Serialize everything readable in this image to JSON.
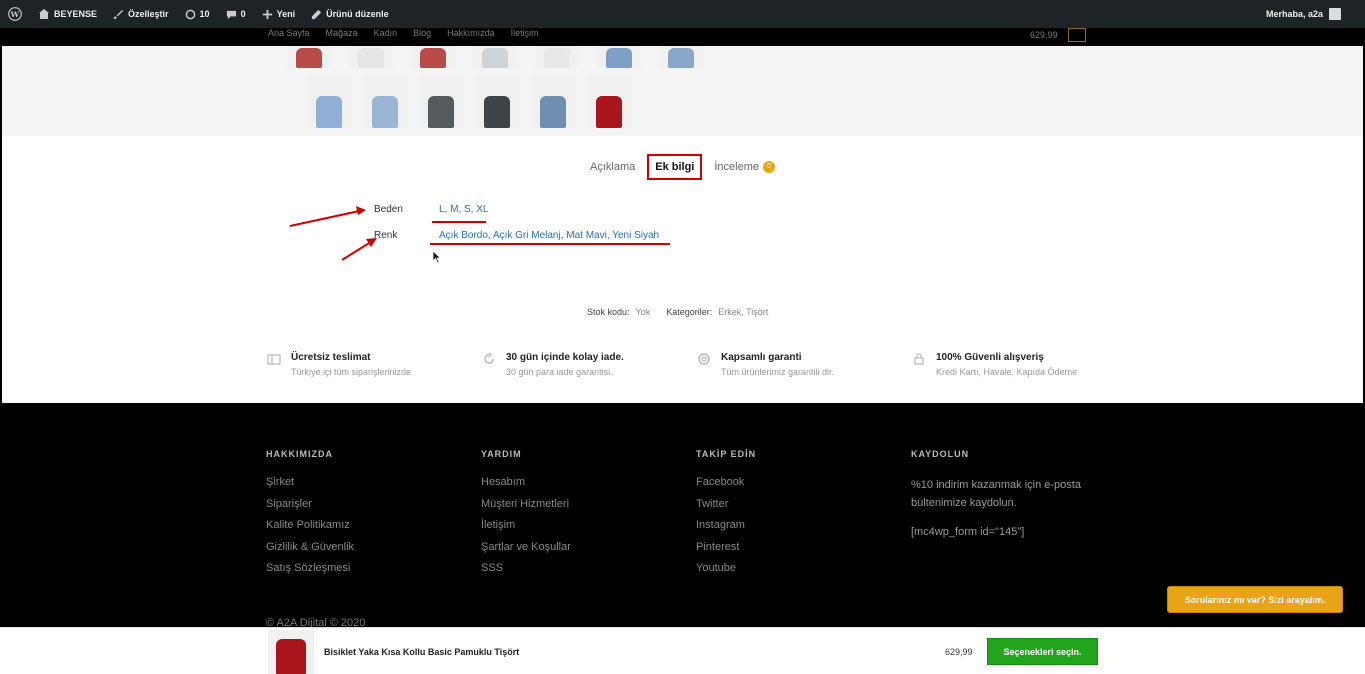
{
  "adminbar": {
    "site_name": "BEYENSE",
    "customize": "Özelleştir",
    "updates_count": "10",
    "comments_count": "0",
    "new": "Yeni",
    "edit_product": "Ürünü düzenle",
    "greeting": "Merhaba, a2a"
  },
  "header": {
    "nav": [
      "Ana Sayfa",
      "Mağaza",
      "Kadın",
      "Blog",
      "Hakkımızda",
      "İletişim"
    ],
    "cart_total": "629,99"
  },
  "thumbnails": {
    "top_colors": [
      "#b84a48",
      "#e5e5e5",
      "#b84a48",
      "#cfd3d8",
      "#e8e8e8",
      "#7ea0c7",
      "#8aa7c9"
    ],
    "bottom_colors": [
      "#8fb0d4",
      "#9ab6d4",
      "#555a5e",
      "#3f4448",
      "#6e8fb0",
      "#a8161c"
    ]
  },
  "tabs": {
    "description": "Açıklama",
    "additional_info": "Ek bilgi",
    "reviews": "İnceleme",
    "reviews_count": "0"
  },
  "attributes": {
    "size_label": "Beden",
    "size_value": "L, M, S, XL",
    "color_label": "Renk",
    "color_value": "Açık Bordo, Açık Gri Melanj, Mat Mavi, Yeni Siyah"
  },
  "meta": {
    "sku_label": "Stok kodu:",
    "sku_value": "Yok",
    "category_label": "Kategoriler:",
    "category_value": "Erkek, Tişört"
  },
  "features": [
    {
      "title": "Ücretsiz teslimat",
      "subtitle": "Türkiye içi tüm siparişlerinizde",
      "icon": "truck-icon"
    },
    {
      "title": "30 gün içinde kolay iade.",
      "subtitle": "30 gün para iade garantisi.",
      "icon": "refresh-icon"
    },
    {
      "title": "Kapsamlı garanti",
      "subtitle": "Tüm ürünlerimiz garantili dir.",
      "icon": "support-icon"
    },
    {
      "title": "100% Güvenli alışveriş",
      "subtitle": "Kredi Kartı, Havale, Kapıda Ödeme",
      "icon": "lock-icon"
    }
  ],
  "footer": {
    "about": {
      "heading": "HAKKIMIZDA",
      "links": [
        "Şirket",
        "Siparişler",
        "Kalite Politikamız",
        "Gizlilik & Güvenlik",
        "Satış Sözleşmesi"
      ]
    },
    "help": {
      "heading": "YARDIM",
      "links": [
        "Hesabım",
        "Müşteri Hizmetleri",
        "İletişim",
        "Şartlar ve Koşullar",
        "SSS"
      ]
    },
    "follow": {
      "heading": "TAKİP EDİN",
      "links": [
        "Facebook",
        "Twitter",
        "Instagram",
        "Pinterest",
        "Youtube"
      ]
    },
    "subscribe": {
      "heading": "KAYDOLUN",
      "text": "%10 indirim kazanmak için e-posta bültenimize kaydolun.",
      "shortcode": "[mc4wp_form id=\"145\"]"
    },
    "copyright": "© A2A Dijital © 2020"
  },
  "call_button": "Sorularınız mı var? Sizi arayalım.",
  "sticky": {
    "title": "Bisiklet Yaka Kısa Kollu Basic Pamuklu Tişört",
    "price": "629,99",
    "button": "Seçenekleri seçin."
  },
  "colors": {
    "adminbar_bg": "#1d2327",
    "accent_orange": "#e8a317",
    "buy_green": "#22a51c",
    "annotation_red": "#cc0000",
    "link_blue": "#2a6fb0"
  }
}
